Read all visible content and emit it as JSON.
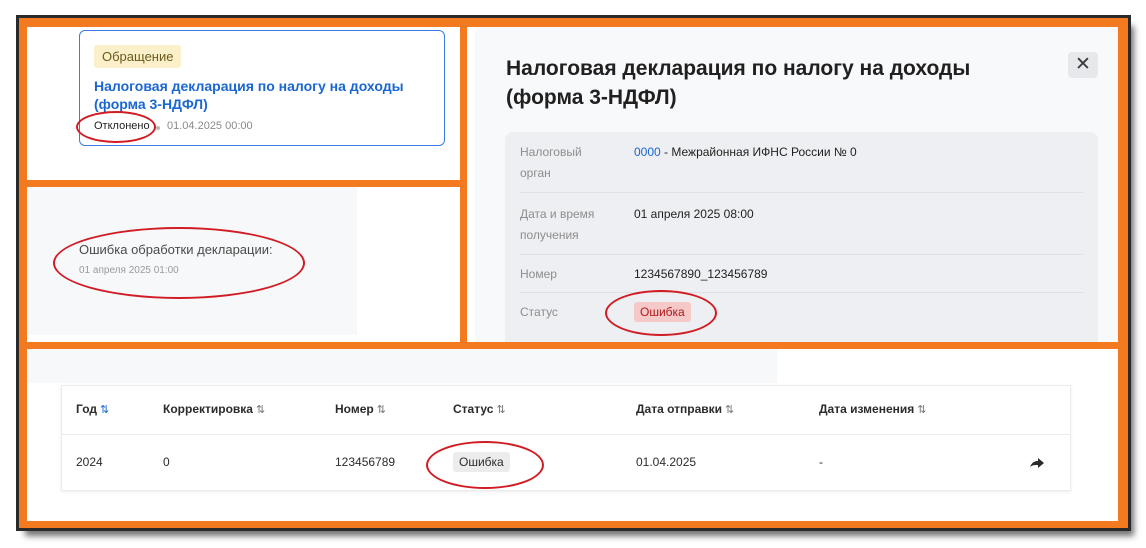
{
  "card": {
    "type_badge": "Обращение",
    "title": "Налоговая декларация по налогу на доходы (форма 3-НДФЛ)",
    "status": "Отклонено",
    "date": "01.04.2025 00:00"
  },
  "error_event": {
    "title": "Ошибка обработки декларации:",
    "date": "01 апреля 2025 01:00"
  },
  "detail": {
    "title": "Налоговая декларация по налогу на доходы (форма 3-НДФЛ)",
    "close_label": "✕",
    "rows": [
      {
        "label": "Налоговый орган",
        "code": "0000",
        "value": " - Межрайонная ИФНС России № 0"
      },
      {
        "label": "Дата и время получения",
        "value": "01 апреля 2025 08:00"
      },
      {
        "label": "Номер",
        "value": "1234567890_123456789"
      },
      {
        "label": "Статус",
        "value": "Ошибка"
      }
    ]
  },
  "table": {
    "headers": [
      "Год",
      "Корректировка",
      "Номер",
      "Статус",
      "Дата отправки",
      "Дата изменения"
    ],
    "sort_icon": "⇅",
    "rows": [
      {
        "year": "2024",
        "correction": "0",
        "number": "123456789",
        "status": "Ошибка",
        "sent": "01.04.2025",
        "changed": "-"
      }
    ]
  },
  "colors": {
    "frame": "#f47a20",
    "link": "#1a66d2",
    "error_bg": "#f6c9c9",
    "error_text": "#b01818",
    "annotation": "#d11c24"
  },
  "icons": {
    "close": "close-icon",
    "sort": "sort-icon",
    "forward": "forward-icon"
  }
}
